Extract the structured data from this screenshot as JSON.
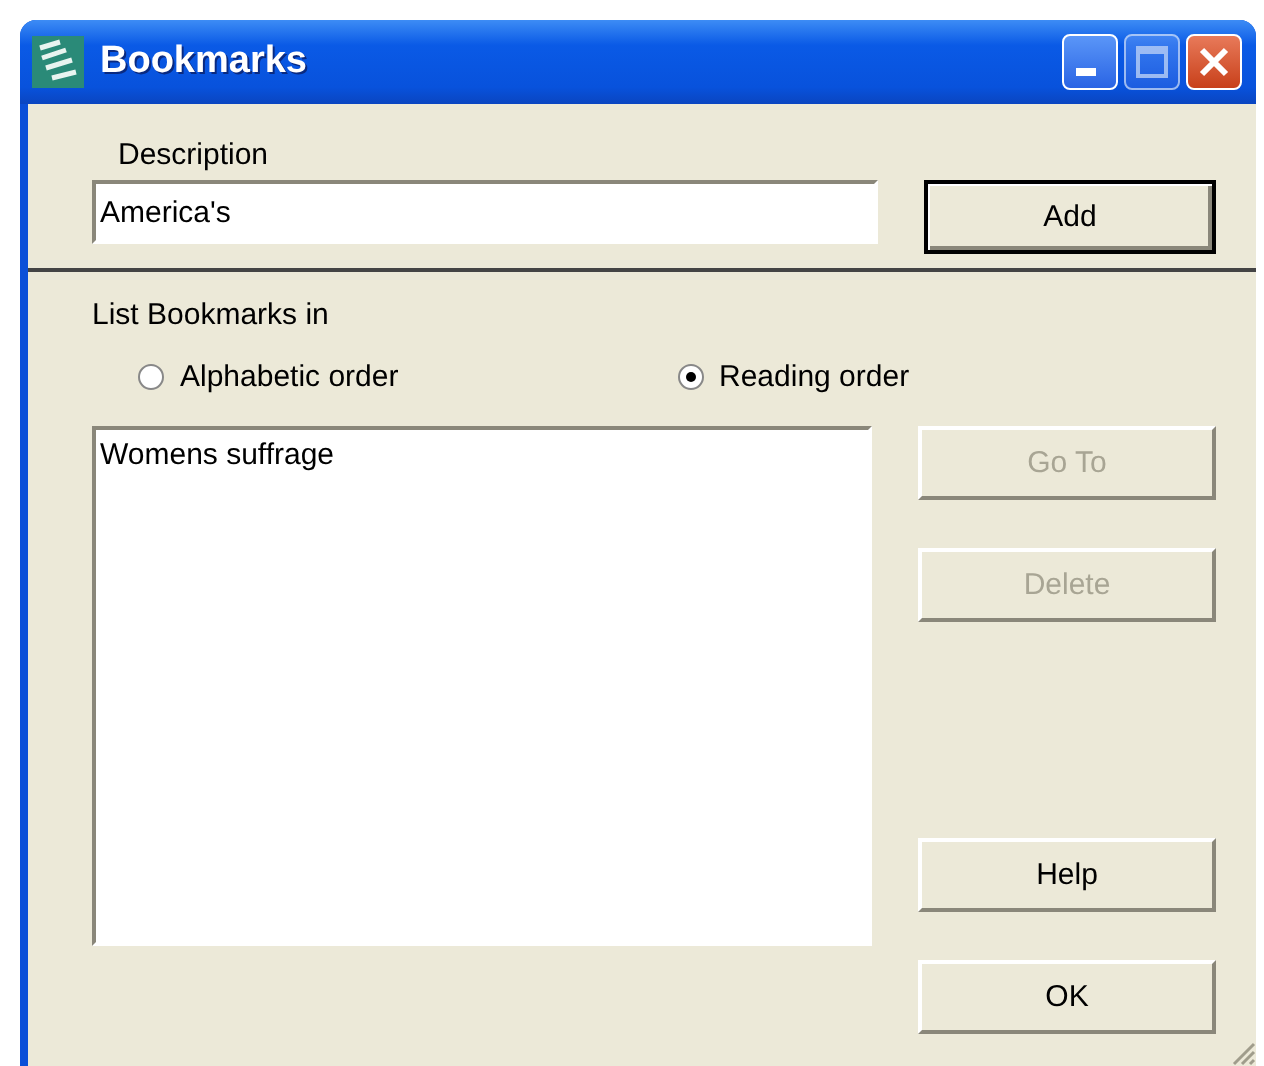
{
  "window": {
    "title": "Bookmarks"
  },
  "description": {
    "label": "Description",
    "value": "America's"
  },
  "add_button": {
    "label": "Add",
    "default": true
  },
  "list_in": {
    "label": "List Bookmarks in",
    "options": [
      {
        "label": "Alphabetic order",
        "selected": false
      },
      {
        "label": "Reading order",
        "selected": true
      }
    ]
  },
  "bookmarks": [
    {
      "label": "Womens suffrage"
    }
  ],
  "buttons": [
    {
      "label": "Go To",
      "disabled": true
    },
    {
      "label": "Delete",
      "disabled": true
    },
    {
      "label": "Help",
      "disabled": false
    },
    {
      "label": "OK",
      "disabled": false
    }
  ]
}
